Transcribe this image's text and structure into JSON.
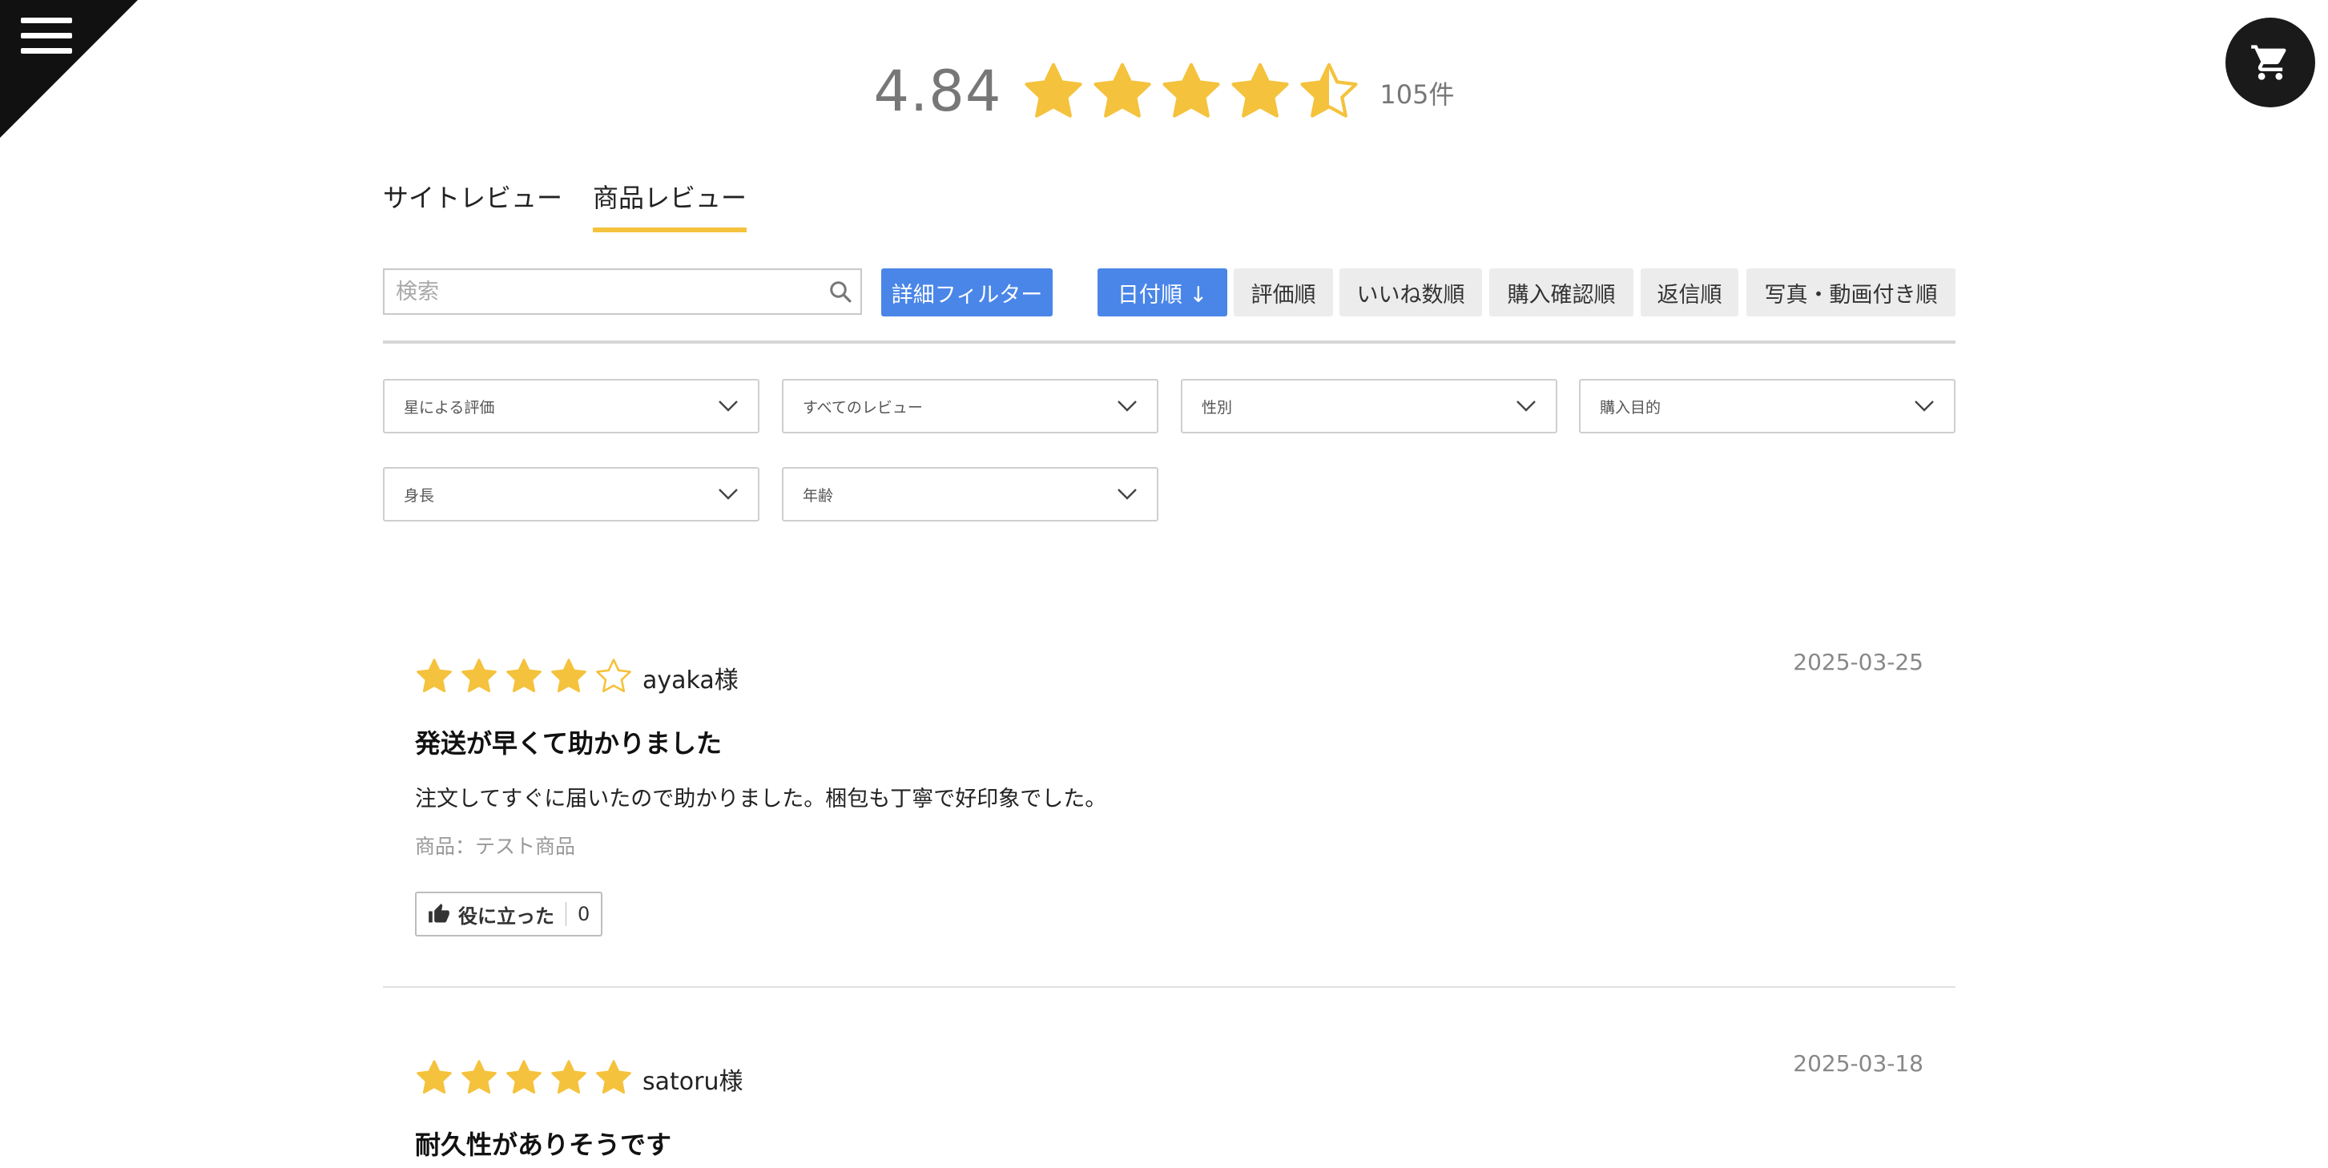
{
  "summary": {
    "average": "4.84",
    "count": "105件",
    "stars": [
      "full",
      "full",
      "full",
      "full",
      "half"
    ]
  },
  "tabs": [
    {
      "label": "サイトレビュー",
      "active": false
    },
    {
      "label": "商品レビュー",
      "active": true
    }
  ],
  "search": {
    "placeholder": "検索",
    "value": ""
  },
  "detail_filter_label": "詳細フィルター",
  "sort": {
    "active_label": "日付順 ↓",
    "options": [
      "評価順",
      "いいね数順",
      "購入確認順",
      "返信順",
      "写真・動画付き順"
    ]
  },
  "filters": [
    "星による評価",
    "すべてのレビュー",
    "性別",
    "購入目的",
    "身長",
    "年齢"
  ],
  "reviews": [
    {
      "stars": [
        "full",
        "full",
        "full",
        "full",
        "empty"
      ],
      "name": "ayaka様",
      "date": "2025-03-25",
      "title": "発送が早くて助かりました",
      "body": "注文してすぐに届いたので助かりました。梱包も丁寧で好印象でした。",
      "product": "商品：テスト商品",
      "helpful_label": "役に立った",
      "helpful_count": "0"
    },
    {
      "stars": [
        "full",
        "full",
        "full",
        "full",
        "full"
      ],
      "name": "satoru様",
      "date": "2025-03-18",
      "title": "耐久性がありそうです"
    }
  ],
  "colors": {
    "star": "#f4c23c",
    "accent_blue": "#4a86e8",
    "tab_underline": "#f4c23c"
  },
  "icons": {
    "menu": "hamburger-menu-icon",
    "cart": "shopping-cart-icon",
    "search": "search-icon",
    "chevron": "chevron-down-icon",
    "thumb": "thumbs-up-icon",
    "star": "star-icon"
  }
}
